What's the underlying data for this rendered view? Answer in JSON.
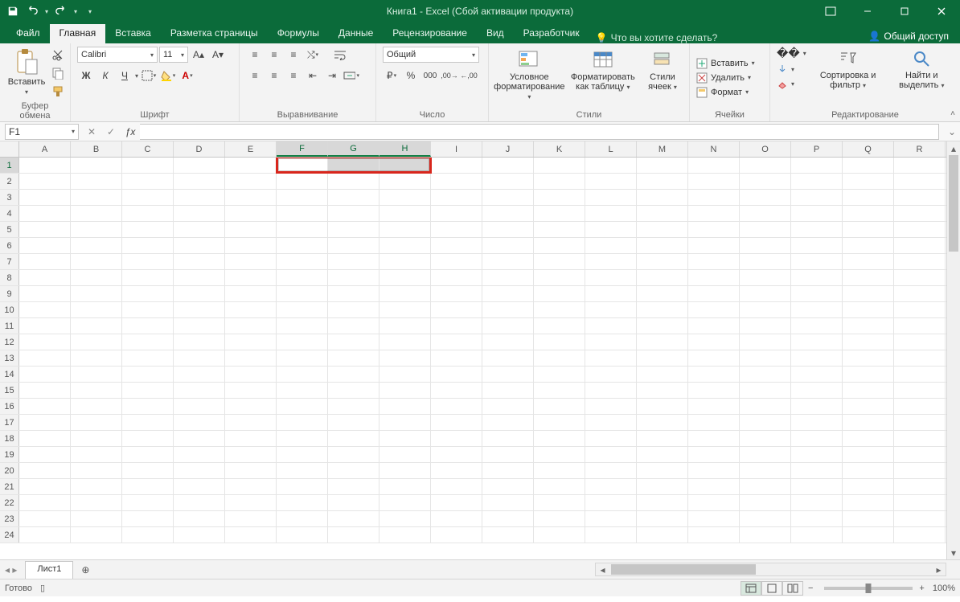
{
  "window": {
    "title": "Книга1 - Excel (Сбой активации продукта)"
  },
  "tabs": {
    "file": "Файл",
    "items": [
      "Главная",
      "Вставка",
      "Разметка страницы",
      "Формулы",
      "Данные",
      "Рецензирование",
      "Вид",
      "Разработчик"
    ],
    "active_index": 0,
    "tell_me": "Что вы хотите сделать?",
    "share": "Общий доступ"
  },
  "ribbon": {
    "clipboard": {
      "paste": "Вставить",
      "group": "Буфер обмена"
    },
    "font": {
      "name": "Calibri",
      "size": "11",
      "group": "Шрифт"
    },
    "alignment": {
      "group": "Выравнивание"
    },
    "number": {
      "format": "Общий",
      "group": "Число"
    },
    "styles": {
      "cond": "Условное форматирование",
      "table": "Форматировать как таблицу",
      "cell": "Стили ячеек",
      "group": "Стили"
    },
    "cells": {
      "insert": "Вставить",
      "delete": "Удалить",
      "format": "Формат",
      "group": "Ячейки"
    },
    "editing": {
      "sort": "Сортировка и фильтр",
      "find": "Найти и выделить",
      "group": "Редактирование"
    }
  },
  "formula_bar": {
    "name_box": "F1",
    "formula": ""
  },
  "grid": {
    "columns": [
      "A",
      "B",
      "C",
      "D",
      "E",
      "F",
      "G",
      "H",
      "I",
      "J",
      "K",
      "L",
      "M",
      "N",
      "O",
      "P",
      "Q",
      "R"
    ],
    "rows": [
      1,
      2,
      3,
      4,
      5,
      6,
      7,
      8,
      9,
      10,
      11,
      12,
      13,
      14,
      15,
      16,
      17,
      18,
      19,
      20,
      21,
      22,
      23,
      24
    ],
    "selection": {
      "row": 1,
      "col_start": "F",
      "col_end": "H",
      "active": "F1"
    }
  },
  "sheets": {
    "active": "Лист1"
  },
  "statusbar": {
    "ready": "Готово",
    "zoom": "100%"
  }
}
